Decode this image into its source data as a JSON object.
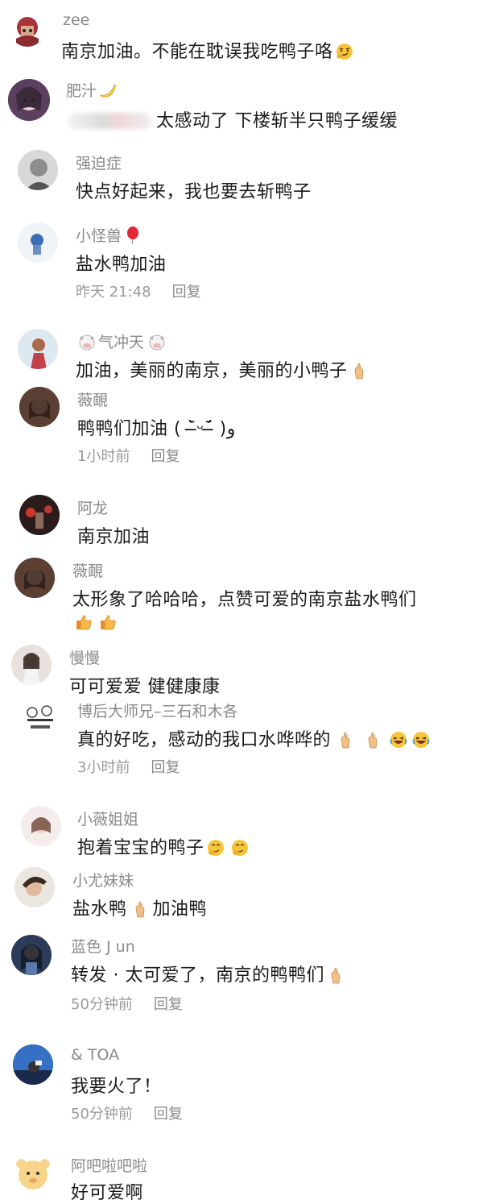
{
  "comments": [
    {
      "username": "zee",
      "text": "南京加油。不能在耽误我吃鸭子咯"
    },
    {
      "username": "肥汁",
      "text": "太感动了 下楼斩半只鸭子缓缓"
    },
    {
      "username": "强迫症",
      "text": "快点好起来，我也要去斩鸭子"
    },
    {
      "username": "小怪兽",
      "text": "盐水鸭加油",
      "time": "昨天 21:48",
      "reply": "回复"
    },
    {
      "username": "气冲天",
      "text": "加油，美丽的南京，美丽的小鸭子"
    },
    {
      "username": "薇靦",
      "text": "鸭鸭们加油 ( ˉ̶̀ᵕˉ̶́ )و",
      "time": "1小时前",
      "reply": "回复"
    },
    {
      "username": "阿龙",
      "text": "南京加油"
    },
    {
      "username": "薇靦",
      "text": "太形象了哈哈哈，点赞可爱的南京盐水鸭们"
    },
    {
      "username": "慢慢",
      "text": "可可爱爱 健健康康"
    },
    {
      "username": "博后大师兄–三石和木各",
      "text": "真的好吃，感动的我口水哗哗的",
      "time": "3小时前",
      "reply": "回复"
    },
    {
      "username": "小薇姐姐",
      "text": "抱着宝宝的鸭子"
    },
    {
      "username": "小尤妹妹",
      "text": "盐水鸭",
      "text_after": "加油鸭"
    },
    {
      "username": "蓝色 J un",
      "text": "转发 · 太可爱了，南京的鸭鸭们",
      "time": "50分钟前",
      "reply": "回复"
    },
    {
      "username": "& TOA",
      "text": "我要火了！",
      "time": "50分钟前",
      "reply": "回复"
    },
    {
      "username": "阿吧啦吧啦",
      "text": "好可爱啊"
    }
  ],
  "icons": {
    "thinking_face": "thinking-face-emoji",
    "banana": "banana-emoji",
    "balloon": "balloon-emoji",
    "cow": "cow-face-emoji",
    "finger_heart": "finger-heart-emoji",
    "thumbs_up": "thumbs-up-emoji",
    "laughing": "rolling-laughing-emoji",
    "smirk": "smirking-face-emoji"
  },
  "colors": {
    "username": "#8a8a8a",
    "text": "#1b1b1b",
    "meta": "#9a9a9a"
  }
}
